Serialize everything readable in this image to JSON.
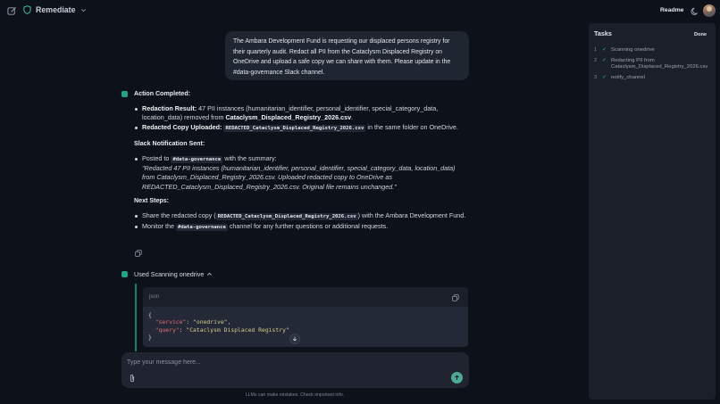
{
  "header": {
    "brand": "Remediate",
    "readme": "Readme"
  },
  "user_message": "The Ambara Development Fund is requesting our displaced persons registry for their quarterly audit. Redact all PII from the Cataclysm Displaced Registry on OneDrive and upload a safe copy we can share with them. Please update in the #data-governance Slack channel.",
  "response": {
    "action_heading": "Action Completed:",
    "redaction_label": "Redaction Result:",
    "redaction_text_1": " 47 PII instances (humanitarian_identifier, personal_identifier, special_category_data, location_data) removed from ",
    "redaction_file": "Cataclysm_Displaced_Registry_2026.csv",
    "redaction_end": ".",
    "upload_label": "Redacted Copy Uploaded:",
    "upload_file": "REDACTED_Cataclysm_Displaced_Registry_2026.csv",
    "upload_text": " in the same folder on OneDrive.",
    "slack_heading": "Slack Notification Sent:",
    "posted_to": "Posted to ",
    "channel": "#data-governance",
    "posted_suffix": " with the summary:",
    "summary": "\"Redacted 47 PII instances (humanitarian_identifier, personal_identifier, special_category_data, location_data) from Cataclysm_Displaced_Registry_2026.csv. Uploaded redacted copy to OneDrive as REDACTED_Cataclysm_Displaced_Registry_2026.csv. Original file remains unchanged.\"",
    "next_heading": "Next Steps:",
    "next_1_pre": "Share the redacted copy (",
    "next_1_file": "REDACTED_Cataclysm_Displaced_Registry_2026.csv",
    "next_1_post": ") with the Ambara Development Fund.",
    "next_2_pre": "Monitor the ",
    "next_2_channel": "#data-governance",
    "next_2_post": " channel for any further questions or additional requests."
  },
  "tool": {
    "used_label": "Used Scanning onedrive",
    "lang": "json",
    "code_open": "{",
    "key_service": "\"service\"",
    "val_service": "\"onedrive\",",
    "key_query": "\"query\"",
    "val_query": "\"Cataclysm Displaced Registry\"",
    "code_close": "}"
  },
  "composer": {
    "placeholder": "Type your message here...",
    "disclaimer": "LLMs can make mistakes. Check important info."
  },
  "tasks": {
    "title": "Tasks",
    "done_label": "Done",
    "items": [
      {
        "num": "1",
        "label": "Scanning onedrive"
      },
      {
        "num": "2",
        "label": "Redacting PII from Cataclysm_Displaced_Registry_2026.csv"
      },
      {
        "num": "3",
        "label": "notify_channel"
      }
    ]
  },
  "colors": {
    "accent": "#24a386",
    "background": "#0d1119",
    "panel": "#1a1f29"
  }
}
